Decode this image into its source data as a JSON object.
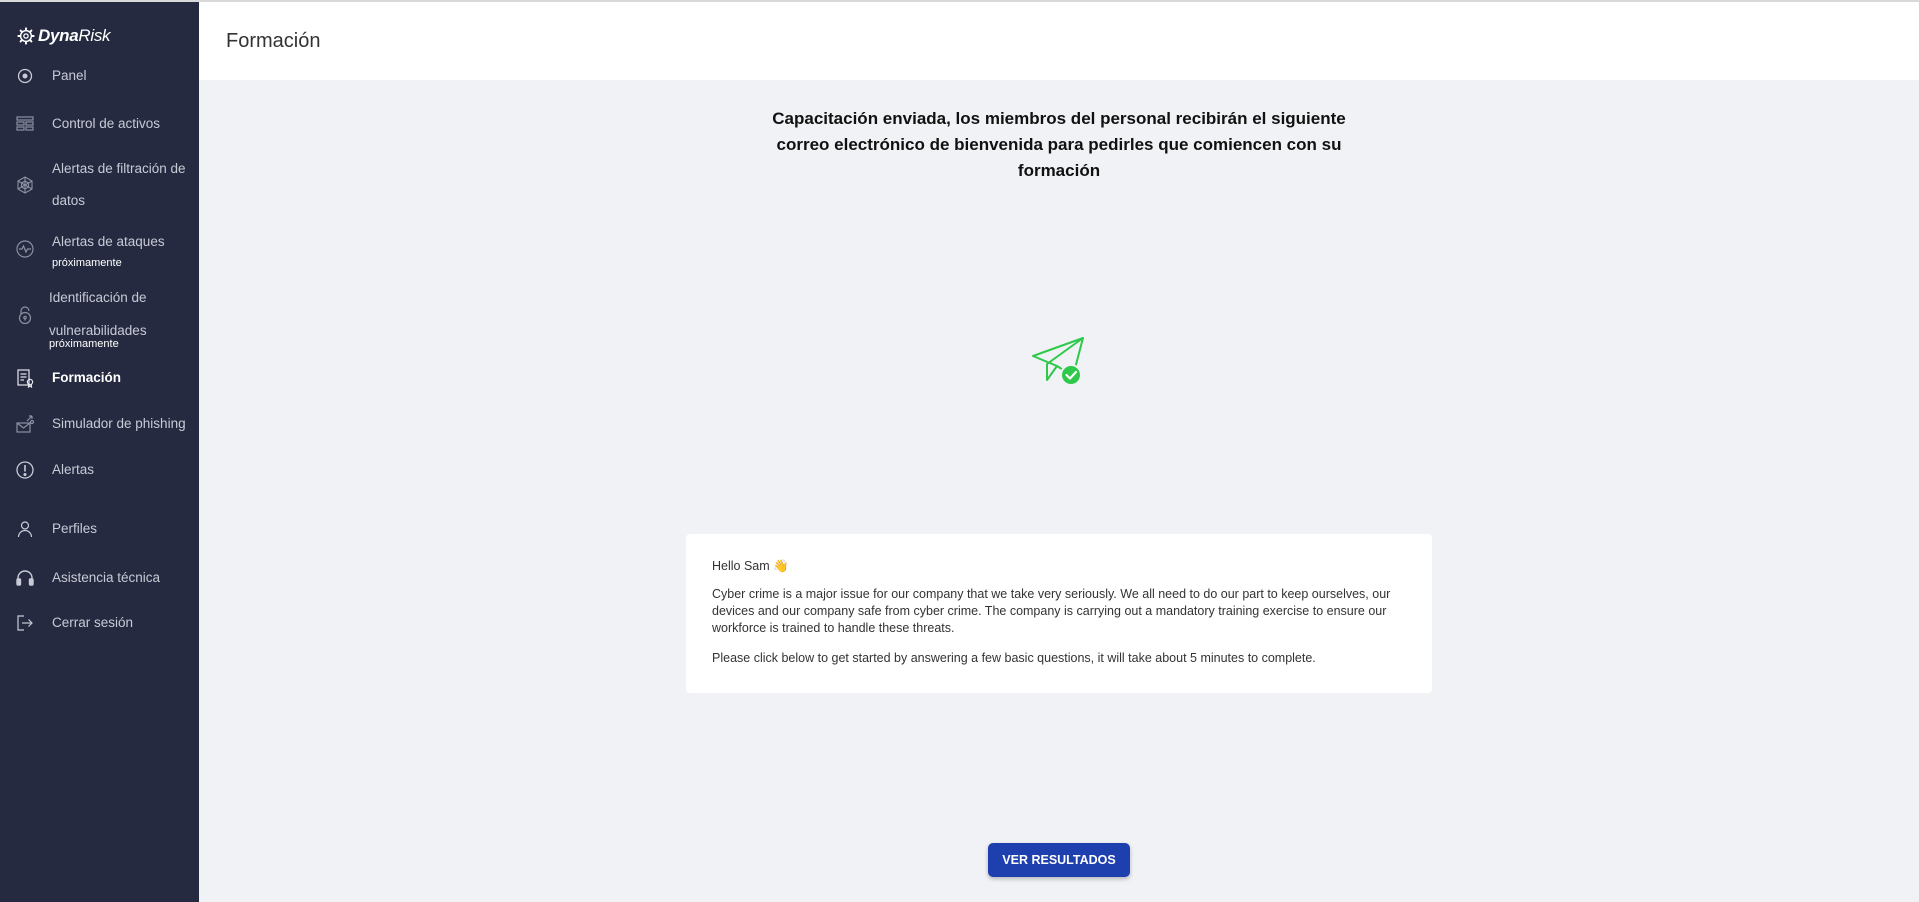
{
  "app": {
    "brand_bold": "Dyna",
    "brand_light": "Risk"
  },
  "colors": {
    "sidebar": "#252a40",
    "accent": "#1e3fae",
    "success": "#2ec94a"
  },
  "sidebar": {
    "items": [
      {
        "label": "Panel",
        "icon": "radar-icon"
      },
      {
        "label": "Control de activos",
        "icon": "assets-table-icon"
      },
      {
        "label_line1": "Alertas de filtración de",
        "label_line2": "datos",
        "icon": "spider-web-icon"
      },
      {
        "label": "Alertas de ataques",
        "sub": "próximamente",
        "icon": "pulse-icon"
      },
      {
        "label_line1": "Identificación de",
        "label_line2": "vulnerabilidades",
        "sub": "próximamente",
        "icon": "lock-icon"
      },
      {
        "label": "Formación",
        "icon": "certificate-icon",
        "active": true
      },
      {
        "label": "Simulador de phishing",
        "icon": "phishing-icon"
      },
      {
        "label": "Alertas",
        "icon": "alert-icon"
      },
      {
        "label": "Perfiles",
        "icon": "user-icon"
      },
      {
        "label": "Asistencia técnica",
        "icon": "headset-icon"
      },
      {
        "label": "Cerrar sesión",
        "icon": "logout-icon"
      }
    ]
  },
  "header": {
    "title": "Formación"
  },
  "main": {
    "headline": "Capacitación enviada, los miembros del personal recibirán el siguiente correo electrónico de bienvenida para pedirles que comiencen con su formación",
    "status_icon": "paper-plane-check-icon",
    "email": {
      "greeting": "Hello Sam 👋",
      "paragraph1": "Cyber crime is a major issue for our company that we take very seriously. We all need to do our part to keep ourselves, our devices and our company safe from cyber crime. The company is carrying out a mandatory training exercise to ensure our workforce is trained to handle these threats.",
      "paragraph2": "Please click below to get started by answering a few basic questions, it will take about 5 minutes to complete."
    },
    "button_label": "VER RESULTADOS"
  }
}
